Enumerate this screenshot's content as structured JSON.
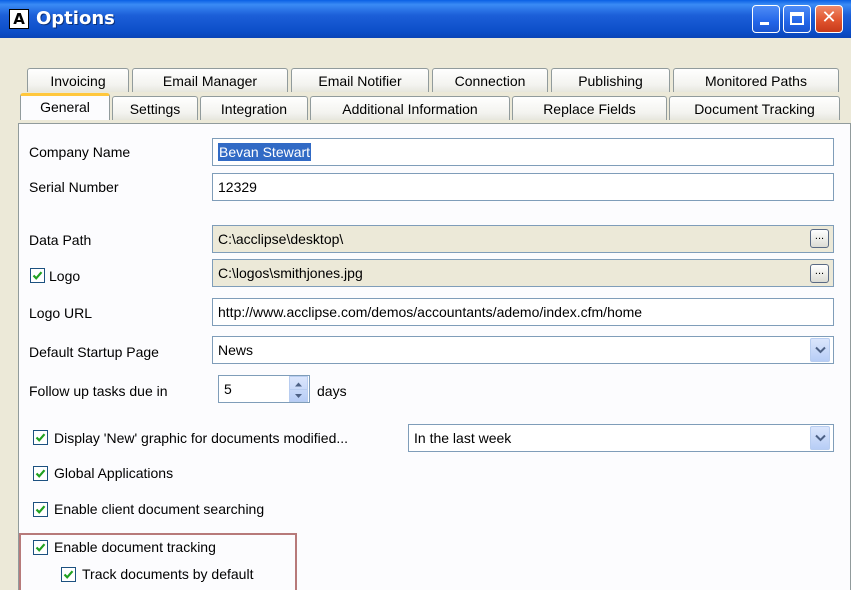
{
  "window": {
    "title": "Options",
    "app_icon": "text-A-icon"
  },
  "titlebar_buttons": {
    "minimize": "minimize-icon",
    "maximize": "maximize-icon",
    "close": "close-icon"
  },
  "tabs_row1": [
    "Invoicing",
    "Email Manager",
    "Email Notifier",
    "Connection",
    "Publishing",
    "Monitored Paths"
  ],
  "tabs_row2": [
    "General",
    "Settings",
    "Integration",
    "Additional Information",
    "Replace Fields",
    "Document Tracking"
  ],
  "active_tab": "General",
  "form": {
    "company_name": {
      "label": "Company Name",
      "value": "Bevan Stewart"
    },
    "serial_number": {
      "label": "Serial Number",
      "value": "12329"
    },
    "data_path": {
      "label": "Data Path",
      "value": "C:\\acclipse\\desktop\\",
      "browse": "..."
    },
    "logo": {
      "label": "Logo",
      "checked": true,
      "value": "C:\\logos\\smithjones.jpg",
      "browse": "..."
    },
    "logo_url": {
      "label": "Logo URL",
      "value": "http://www.acclipse.com/demos/accountants/ademo/index.cfm/home"
    },
    "default_startup_page": {
      "label": "Default Startup Page",
      "value": "News"
    },
    "follow_up": {
      "label": "Follow up tasks due in",
      "value": "5",
      "unit": "days"
    },
    "display_new": {
      "label": "Display 'New' graphic for documents modified...",
      "checked": true,
      "value": "In the last week"
    },
    "global_applications": {
      "label": "Global Applications",
      "checked": true
    },
    "client_search": {
      "label": "Enable client document searching",
      "checked": true
    },
    "doc_tracking": {
      "label": "Enable document tracking",
      "checked": true
    },
    "track_default": {
      "label": "Track documents by default",
      "checked": true
    }
  },
  "colors": {
    "titlebar": "#0b4dc7",
    "selection": "#316ac5",
    "active_tab_accent": "#ffc73c",
    "highlight_border": "#b77a7a",
    "checkmark": "#21a121"
  }
}
